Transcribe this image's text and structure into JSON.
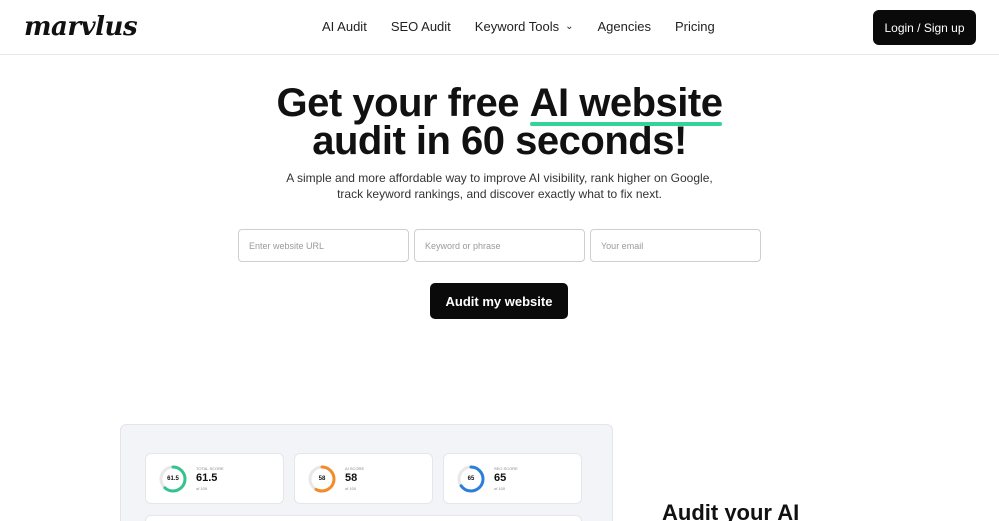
{
  "header": {
    "logo": "marvlus",
    "nav": [
      "AI Audit",
      "SEO Audit",
      "Keyword Tools",
      "Agencies",
      "Pricing"
    ],
    "login_label": "Login / Sign up"
  },
  "hero": {
    "title_part1": "Get your free ",
    "title_highlight": "AI website",
    "title_line2": "audit in 60 seconds!",
    "subtitle_line1": "A simple and more affordable way to improve AI visibility, rank higher on Google,",
    "subtitle_line2": "track keyword rankings, and discover exactly what to fix next."
  },
  "form": {
    "url_placeholder": "Enter website URL",
    "keyword_placeholder": "Keyword or phrase",
    "email_placeholder": "Your email",
    "submit_label": "Audit my website"
  },
  "scores": [
    {
      "label": "TOTAL SCORE",
      "ring_value": "61.5",
      "value": "61.5",
      "sub": "of 100",
      "percent": 61.5,
      "color": "#34c38f"
    },
    {
      "label": "AI SCORE",
      "ring_value": "58",
      "value": "58",
      "sub": "of 100",
      "percent": 58,
      "color": "#f28c28"
    },
    {
      "label": "SEO SCORE",
      "ring_value": "65",
      "value": "65",
      "sub": "of 100",
      "percent": 65,
      "color": "#2b7fd8"
    }
  ],
  "side": {
    "title": "Audit your AI"
  }
}
